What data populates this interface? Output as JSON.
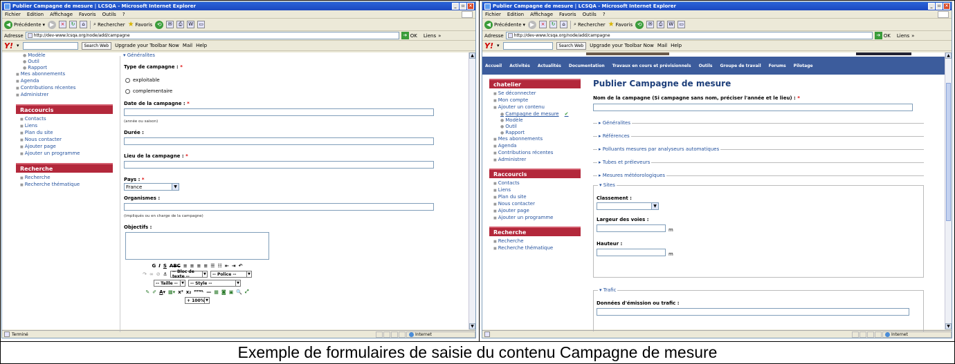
{
  "caption": "Exemple de formulaires de saisie du contenu Campagne de mesure",
  "browser": {
    "title": "Publier Campagne de mesure | LCSQA - Microsoft Internet Explorer",
    "menu": [
      "Fichier",
      "Edition",
      "Affichage",
      "Favoris",
      "Outils",
      "?"
    ],
    "toolbar": {
      "back": "Précédente",
      "search": "Rechercher",
      "favorites": "Favoris"
    },
    "address_label": "Adresse",
    "address_value": "http://dev-www.lcsqa.org/node/add/campagne",
    "go_label": "OK",
    "links_label": "Liens",
    "yahoo": {
      "search_btn": "Search Web",
      "upgrade": "Upgrade your Toolbar Now",
      "mail": "Mail",
      "help": "Help"
    },
    "status_left": "Terminé",
    "status_zone": "Internet"
  },
  "left": {
    "sidebar_top": [
      {
        "label": "Modèle",
        "sub": true
      },
      {
        "label": "Outil",
        "sub": true
      },
      {
        "label": "Rapport",
        "sub": true
      },
      {
        "label": "Mes abonnements",
        "sub": false
      },
      {
        "label": "Agenda",
        "sub": false
      },
      {
        "label": "Contributions récentes",
        "sub": false
      },
      {
        "label": "Administrer",
        "sub": false
      }
    ],
    "raccourcis_title": "Raccourcis",
    "raccourcis": [
      "Contacts",
      "Liens",
      "Plan du site",
      "Nous contacter",
      "Ajouter page",
      "Ajouter un programme"
    ],
    "recherche_title": "Recherche",
    "recherche": [
      "Recherche",
      "Recherche thématique"
    ],
    "form": {
      "legend": "Généralites",
      "type_label": "Type de campagne :",
      "radio1": "exploitable",
      "radio2": "complementaire",
      "date_label": "Date de la campagne :",
      "date_hint": "(année ou saison)",
      "duree_label": "Durée :",
      "lieu_label": "Lieu de la campagne :",
      "pays_label": "Pays :",
      "pays_value": "France",
      "organismes_label": "Organismes :",
      "organismes_hint": "(impliqués ou en charge de la campagne)",
      "objectifs_label": "Objectifs :",
      "editor": {
        "bloc": "-- Bloc de texte --",
        "police": "-- Police --",
        "taille": "-- Taille --",
        "style": "-- Style --",
        "zoom": "+ 100%"
      }
    }
  },
  "right": {
    "nav": [
      "Accueil",
      "Activités",
      "Actualités",
      "Documentation",
      "Travaux en cours et prévisionnels",
      "Outils",
      "Groupe de travail",
      "Forums",
      "Pilotage"
    ],
    "user_block_title": "chatelier",
    "user_items": [
      {
        "label": "Se déconnecter",
        "sub": false
      },
      {
        "label": "Mon compte",
        "sub": false
      },
      {
        "label": "Ajouter un contenu",
        "sub": false
      },
      {
        "label": "Campagne de mesure",
        "sub": true,
        "active": true
      },
      {
        "label": "Modèle",
        "sub": true
      },
      {
        "label": "Outil",
        "sub": true
      },
      {
        "label": "Rapport",
        "sub": true
      },
      {
        "label": "Mes abonnements",
        "sub": false
      },
      {
        "label": "Agenda",
        "sub": false
      },
      {
        "label": "Contributions récentes",
        "sub": false
      },
      {
        "label": "Administrer",
        "sub": false
      }
    ],
    "raccourcis_title": "Raccourcis",
    "raccourcis": [
      "Contacts",
      "Liens",
      "Plan du site",
      "Nous contacter",
      "Ajouter page",
      "Ajouter un programme"
    ],
    "recherche_title": "Recherche",
    "recherche": [
      "Recherche",
      "Recherche thématique"
    ],
    "page_title": "Publier Campagne de mesure",
    "nom_label": "Nom de la campagne (Si campagne sans nom, préciser l'année et le lieu) :",
    "collapsed": [
      "Généralites",
      "Références",
      "Polluants mesures par analyseurs automatiques",
      "Tubes et préleveurs",
      "Mesures météorologiques"
    ],
    "sites_legend": "Sites",
    "classement_label": "Classement :",
    "largeur_label": "Largeur des voies :",
    "hauteur_label": "Hauteur :",
    "unit_m": "m",
    "trafic_legend": "Trafic",
    "donnees_label": "Données d'émission ou trafic :"
  }
}
